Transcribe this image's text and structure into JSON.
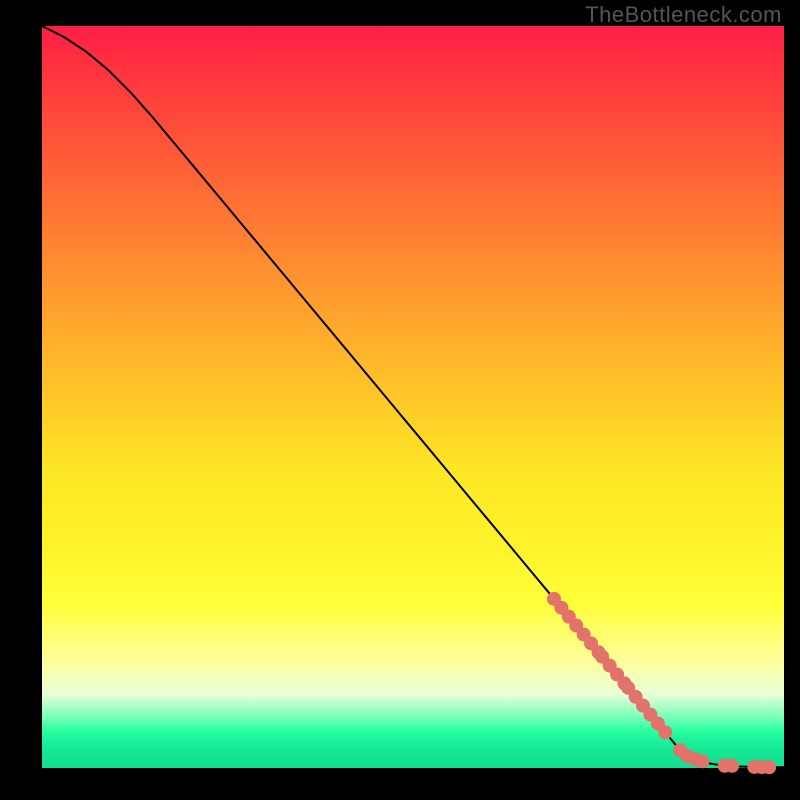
{
  "watermark": "TheBottleneck.com",
  "colors": {
    "marker": "#e2726a",
    "line": "#000000",
    "bg_black": "#000000"
  },
  "chart_data": {
    "type": "line",
    "title": "",
    "xlabel": "",
    "ylabel": "",
    "xlim": [
      0,
      100
    ],
    "ylim": [
      0,
      100
    ],
    "series": [
      {
        "name": "curve",
        "x": [
          0,
          3,
          6,
          9,
          12,
          15,
          18,
          21,
          24,
          27,
          30,
          33,
          36,
          39,
          42,
          45,
          48,
          51,
          54,
          57,
          60,
          63,
          66,
          69,
          72,
          75,
          78,
          81,
          84,
          86,
          88,
          90,
          92,
          94,
          96,
          98,
          100
        ],
        "y": [
          100,
          98.5,
          96.5,
          94,
          91,
          87.6,
          84,
          80.4,
          76.8,
          73.2,
          69.6,
          66,
          62.4,
          58.8,
          55.2,
          51.6,
          48,
          44.4,
          40.8,
          37.2,
          33.6,
          30,
          26.4,
          22.8,
          19.2,
          15.6,
          12,
          8.4,
          4.8,
          2.4,
          1.2,
          0.6,
          0.3,
          0.2,
          0.15,
          0.1,
          0.1
        ]
      }
    ],
    "markers": {
      "name": "points",
      "x": [
        69,
        70,
        71,
        72,
        73,
        74,
        75,
        75.5,
        76.5,
        77.5,
        78.5,
        79,
        80,
        81,
        82,
        83,
        84,
        86,
        87,
        88,
        89,
        92,
        93,
        96,
        97,
        98
      ],
      "y": [
        22.8,
        21.6,
        20.4,
        19.2,
        18.0,
        16.8,
        15.6,
        15.0,
        13.8,
        12.6,
        11.4,
        10.8,
        9.6,
        8.4,
        7.2,
        6.0,
        4.8,
        2.4,
        1.6,
        1.2,
        0.9,
        0.3,
        0.3,
        0.15,
        0.12,
        0.1
      ]
    }
  }
}
